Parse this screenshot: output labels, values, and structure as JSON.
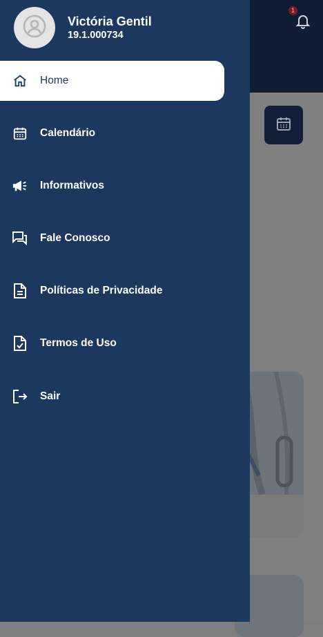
{
  "user": {
    "name": "Victória Gentil",
    "id": "19.1.000734"
  },
  "notifications": {
    "count": "1"
  },
  "menu": [
    {
      "label": "Home",
      "icon": "home-icon",
      "active": true
    },
    {
      "label": "Calendário",
      "icon": "calendar-icon"
    },
    {
      "label": "Informativos",
      "icon": "megaphone-icon"
    },
    {
      "label": "Fale Conosco",
      "icon": "chat-icon"
    },
    {
      "label": "Políticas de Privacidade",
      "icon": "document-icon"
    },
    {
      "label": "Termos de Uso",
      "icon": "document-check-icon"
    },
    {
      "label": "Sair",
      "icon": "logout-icon"
    }
  ],
  "colors": {
    "drawer": "#1d385f",
    "header": "#0e1d33",
    "badge": "#7d1a1c"
  }
}
